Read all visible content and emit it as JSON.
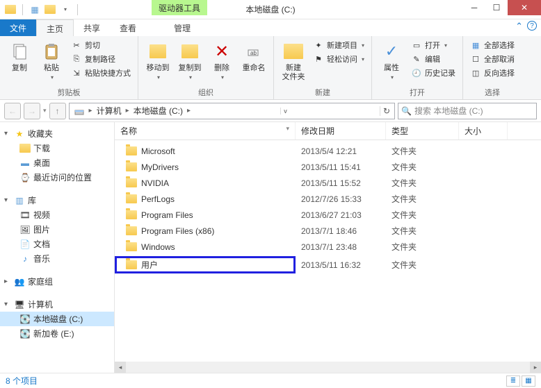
{
  "titlebar": {
    "drive_tools_label": "驱动器工具",
    "title": "本地磁盘 (C:)"
  },
  "ribbon_tabs": {
    "file": "文件",
    "home": "主页",
    "share": "共享",
    "view": "查看",
    "manage": "管理"
  },
  "ribbon": {
    "clipboard": {
      "copy": "复制",
      "paste": "粘贴",
      "cut": "剪切",
      "copy_path": "复制路径",
      "paste_shortcut": "粘贴快捷方式",
      "group_label": "剪贴板"
    },
    "organize": {
      "move_to": "移动到",
      "copy_to": "复制到",
      "delete": "删除",
      "rename": "重命名",
      "group_label": "组织"
    },
    "new": {
      "new_folder": "新建\n文件夹",
      "new_item": "新建项目",
      "easy_access": "轻松访问",
      "group_label": "新建"
    },
    "open": {
      "properties": "属性",
      "open": "打开",
      "edit": "编辑",
      "history": "历史记录",
      "group_label": "打开"
    },
    "select": {
      "select_all": "全部选择",
      "select_none": "全部取消",
      "invert": "反向选择",
      "group_label": "选择"
    }
  },
  "breadcrumb": {
    "computer": "计算机",
    "drive": "本地磁盘 (C:)"
  },
  "search": {
    "placeholder": "搜索 本地磁盘 (C:)"
  },
  "navpane": {
    "favorites": {
      "label": "收藏夹",
      "items": [
        "下载",
        "桌面",
        "最近访问的位置"
      ]
    },
    "libraries": {
      "label": "库",
      "items": [
        "视频",
        "图片",
        "文档",
        "音乐"
      ]
    },
    "homegroup": {
      "label": "家庭组"
    },
    "computer": {
      "label": "计算机",
      "items": [
        "本地磁盘 (C:)",
        "新加卷 (E:)"
      ]
    }
  },
  "columns": {
    "name": "名称",
    "date": "修改日期",
    "type": "类型",
    "size": "大小"
  },
  "files": [
    {
      "name": "Microsoft",
      "date": "2013/5/4 12:21",
      "type": "文件夹"
    },
    {
      "name": "MyDrivers",
      "date": "2013/5/11 15:41",
      "type": "文件夹"
    },
    {
      "name": "NVIDIA",
      "date": "2013/5/11 15:52",
      "type": "文件夹"
    },
    {
      "name": "PerfLogs",
      "date": "2012/7/26 15:33",
      "type": "文件夹"
    },
    {
      "name": "Program Files",
      "date": "2013/6/27 21:03",
      "type": "文件夹"
    },
    {
      "name": "Program Files (x86)",
      "date": "2013/7/1 18:46",
      "type": "文件夹"
    },
    {
      "name": "Windows",
      "date": "2013/7/1 23:48",
      "type": "文件夹"
    },
    {
      "name": "用户",
      "date": "2013/5/11 16:32",
      "type": "文件夹",
      "highlighted": true
    }
  ],
  "statusbar": {
    "item_count": "8 个项目"
  }
}
